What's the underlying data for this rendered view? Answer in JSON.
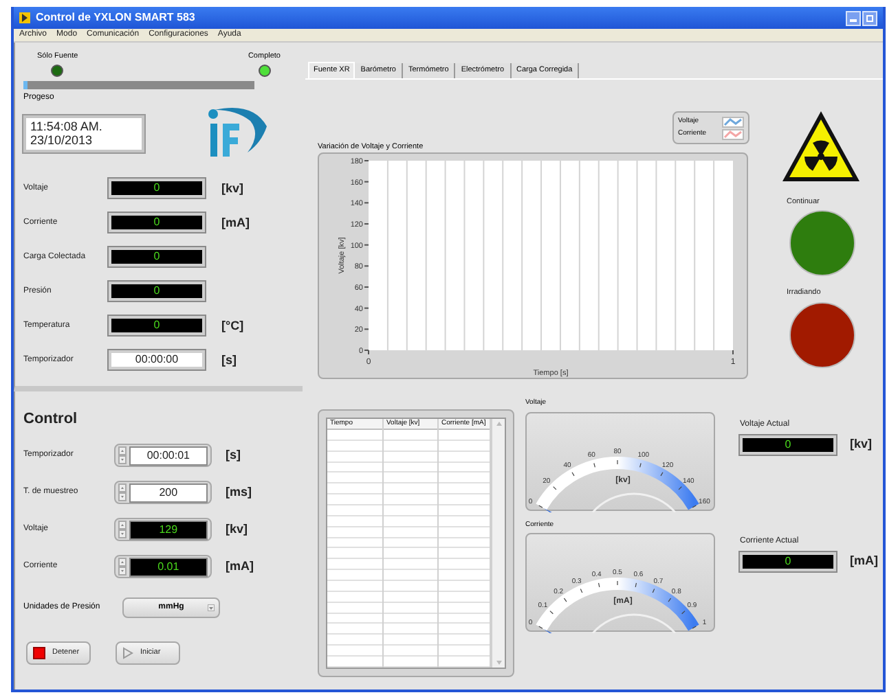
{
  "window": {
    "title": "Control de YXLON SMART 583"
  },
  "menu": [
    "Archivo",
    "Modo",
    "Comunicación",
    "Configuraciones",
    "Ayuda"
  ],
  "status_leds": [
    {
      "label": "Sólo Fuente",
      "on": false
    },
    {
      "label": "Completo",
      "on": true
    }
  ],
  "progress": {
    "label": "Progeso",
    "level": 0.02
  },
  "clock": {
    "time": "11:54:08 AM.",
    "date": "23/10/2013"
  },
  "readings": [
    {
      "label": "Voltaje",
      "value": "0",
      "unit": "[kv]",
      "kind": "display"
    },
    {
      "label": "Corriente",
      "value": "0",
      "unit": "[mA]",
      "kind": "display"
    },
    {
      "label": "Carga Colectada",
      "value": "0",
      "kind": "display"
    },
    {
      "label": "Presión",
      "value": "0",
      "kind": "display"
    },
    {
      "label": "Temperatura",
      "value": "0",
      "unit": "[°C]",
      "kind": "display"
    },
    {
      "label": "Temporizador",
      "value": "00:00:00",
      "unit": "[s]",
      "kind": "text"
    }
  ],
  "control": {
    "title": "Control",
    "inputs": [
      {
        "label": "Temporizador",
        "value": "00:00:01",
        "unit": "[s]",
        "kind": "text"
      },
      {
        "label": "T. de muestreo",
        "value": "200",
        "unit": "[ms]",
        "kind": "text"
      },
      {
        "label": "Voltaje",
        "value": "129",
        "unit": "[kv]",
        "kind": "display"
      },
      {
        "label": "Corriente",
        "value": "0.01",
        "unit": "[mA]",
        "kind": "display"
      }
    ],
    "pressure_units": {
      "label": "Unidades de Presión",
      "value": "mmHg"
    },
    "buttons": [
      {
        "label": "Detener",
        "kind": "stop"
      },
      {
        "label": "Iniciar",
        "kind": "start"
      }
    ]
  },
  "tabs": [
    {
      "label": "Fuente XR",
      "selected": true
    },
    {
      "label": "Barómetro",
      "selected": false
    },
    {
      "label": "Termómetro",
      "selected": false
    },
    {
      "label": "Electrómetro",
      "selected": false
    },
    {
      "label": "Carga Corregida",
      "selected": false
    }
  ],
  "chart": {
    "chart_panel": {
      "title": "Variación de Voltaje y Corriente",
      "xlabel": "Tiempo [s]",
      "ylabel": "Voltaje [kv]",
      "xticks": [
        "0",
        "1"
      ],
      "yticks": [
        "180",
        "160",
        "140",
        "120",
        "100",
        "80",
        "60",
        "40",
        "20",
        "0"
      ],
      "series": [
        {
          "name": "Voltaje",
          "color": "#6fa8dc"
        },
        {
          "name": "Corriente",
          "color": "#f4a6a6"
        }
      ]
    }
  },
  "table": {
    "columns": [
      "Tiempo",
      "Voltaje [kv]",
      "Corriente [mA]"
    ]
  },
  "gauges": [
    {
      "title": "Voltaje",
      "unit": "[kv]",
      "scale": [
        "0",
        "20",
        "40",
        "60",
        "80",
        "100",
        "120",
        "140",
        "160"
      ]
    },
    {
      "title": "Corriente",
      "unit": "[mA]",
      "scale": [
        "0",
        "0.1",
        "0.2",
        "0.3",
        "0.4",
        "0.5",
        "0.6",
        "0.7",
        "0.8",
        "0.9",
        "1"
      ]
    }
  ],
  "actual": [
    {
      "label": "Voltaje Actual",
      "value": "0",
      "unit": "[kv]"
    },
    {
      "label": "Corriente Actual",
      "value": "0",
      "unit": "[mA]"
    }
  ],
  "indicators": [
    {
      "label": "Continuar",
      "color": "#2e7d0e"
    },
    {
      "label": "Irradiando",
      "color": "#a11a00"
    }
  ]
}
